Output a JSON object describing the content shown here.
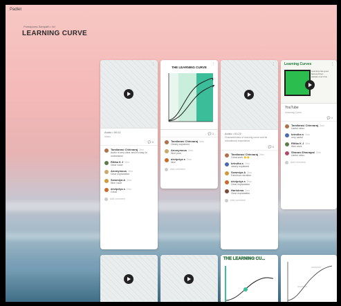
{
  "app": {
    "brand": "Padlet",
    "breadcrumb": "Pomaporas Sampath • 4d",
    "title": "LEARNING CURVE"
  },
  "columns": [
    {
      "meta": "Audio • 00:11",
      "submeta": "Video",
      "desc": "",
      "comment_count": "5",
      "comments": [
        {
          "name": "Tamilarasi Chinnaraj",
          "time": "2mo",
          "text": "Audio is very clear and it's easy to understand",
          "color": "#b0704a"
        },
        {
          "name": "Ritika K J",
          "time": "2mo",
          "text": "Clear voice",
          "color": "#5a7d4a"
        },
        {
          "name": "Anonymous",
          "time": "2mo",
          "text": "Clear explanation",
          "color": "#c9a86a"
        },
        {
          "name": "Sowmiya A",
          "time": "2mo",
          "text": "Nice voice",
          "color": "#d49a3a"
        },
        {
          "name": "devipriya s",
          "time": "2mo",
          "text": "Great",
          "color": "#c86a2a"
        }
      ],
      "add_comment": "Add comment"
    },
    {
      "thumb_title": "THE LEARNING CURVE",
      "comment_count": "3",
      "comments": [
        {
          "name": "Tamilarasi Chinnaraj",
          "time": "2mo",
          "text": "Clearly explained",
          "color": "#b0704a"
        },
        {
          "name": "Anonymous",
          "time": "2mo",
          "text": "Nice post",
          "color": "#c9a86a"
        },
        {
          "name": "devipriya s",
          "time": "2mo",
          "text": "Nice",
          "color": "#c86a2a"
        }
      ],
      "add_comment": "Add comment"
    },
    {
      "meta": "Audio • 01:22",
      "desc": "Characteristics of learning curve and its educational importance",
      "comment_count": "5",
      "comments": [
        {
          "name": "Tamilarasi Chinnaraj",
          "time": "2mo",
          "text": "Great work 👏👏",
          "color": "#b0704a"
        },
        {
          "name": "brindha s",
          "time": "2mo",
          "text": "clearly explained",
          "color": "#4a6ab0"
        },
        {
          "name": "Sowmiya A",
          "time": "2mo",
          "text": "Fabulous narration",
          "color": "#d49a3a"
        },
        {
          "name": "devipriya s",
          "time": "2mo",
          "text": "Clear explanation",
          "color": "#c86a2a"
        },
        {
          "name": "Harishma",
          "time": "2mo",
          "text": "Clear explanation",
          "color": "#7a4a3a"
        }
      ],
      "add_comment": "Add comment"
    },
    {
      "thumb_title": "Learning Curves",
      "thumb_text": "Learning rate goes fast and then plateau over time",
      "yt_label": "YouTube",
      "yt_sub": "Learning Curve",
      "comment_count": "4",
      "comments": [
        {
          "name": "Tamilarasi Chinnaraj",
          "time": "2mo",
          "text": "Useful video",
          "color": "#b0704a"
        },
        {
          "name": "brindha s",
          "time": "2mo",
          "text": "very useful",
          "color": "#4a6ab0"
        },
        {
          "name": "Ritika K J",
          "time": "2mo",
          "text": "Nice work",
          "color": "#5a7d4a"
        },
        {
          "name": "Sharani Dhanapal",
          "time": "2mo",
          "text": "Useful video",
          "color": "#b04a6a"
        }
      ],
      "add_comment": "Add comment"
    }
  ],
  "bottom_row": {
    "third_title": "THE LEARNING CU..."
  },
  "colors": {
    "accent_green": "#2bbd4e",
    "teal": "#3bbd9a"
  }
}
